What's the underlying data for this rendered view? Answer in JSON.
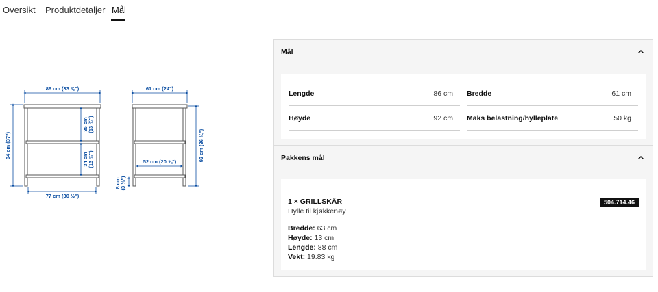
{
  "tabs": [
    {
      "label": "Oversikt"
    },
    {
      "label": "Produktdetaljer"
    },
    {
      "label": "Mål"
    }
  ],
  "drawing": {
    "front_width": "86 cm (33 ⅞\")",
    "inner_width": "77 cm (30 ½\")",
    "total_height": "94 cm (37\")",
    "shelf_gap_upper": "35 cm",
    "shelf_gap_upper_in": "(13 ¾\")",
    "shelf_gap_lower": "34 cm",
    "shelf_gap_lower_in": "(13 ⅜\")",
    "side_depth": "61 cm (24\")",
    "side_inner_depth": "52 cm (20 ⅝\")",
    "side_height": "92 cm (36 ¼\")",
    "foot_height": "8 cm",
    "foot_height_in": "(3 ⅛\")",
    "line_color": "#0b4ea2"
  },
  "dimensions": {
    "title": "Mål",
    "rows": [
      {
        "label": "Lengde",
        "value": "86 cm"
      },
      {
        "label": "Bredde",
        "value": "61 cm"
      },
      {
        "label": "Høyde",
        "value": "92 cm"
      },
      {
        "label": "Maks belastning/hylleplate",
        "value": "50 kg"
      }
    ]
  },
  "package": {
    "title": "Pakkens mål",
    "item_title": "1 × GRILLSKÄR",
    "item_desc": "Hylle til kjøkkenøy",
    "article_number": "504.714.46",
    "lines": [
      {
        "label": "Bredde:",
        "value": "63 cm"
      },
      {
        "label": "Høyde:",
        "value": "13 cm"
      },
      {
        "label": "Lengde:",
        "value": "88 cm"
      },
      {
        "label": "Vekt:",
        "value": "19.83 kg"
      }
    ]
  }
}
